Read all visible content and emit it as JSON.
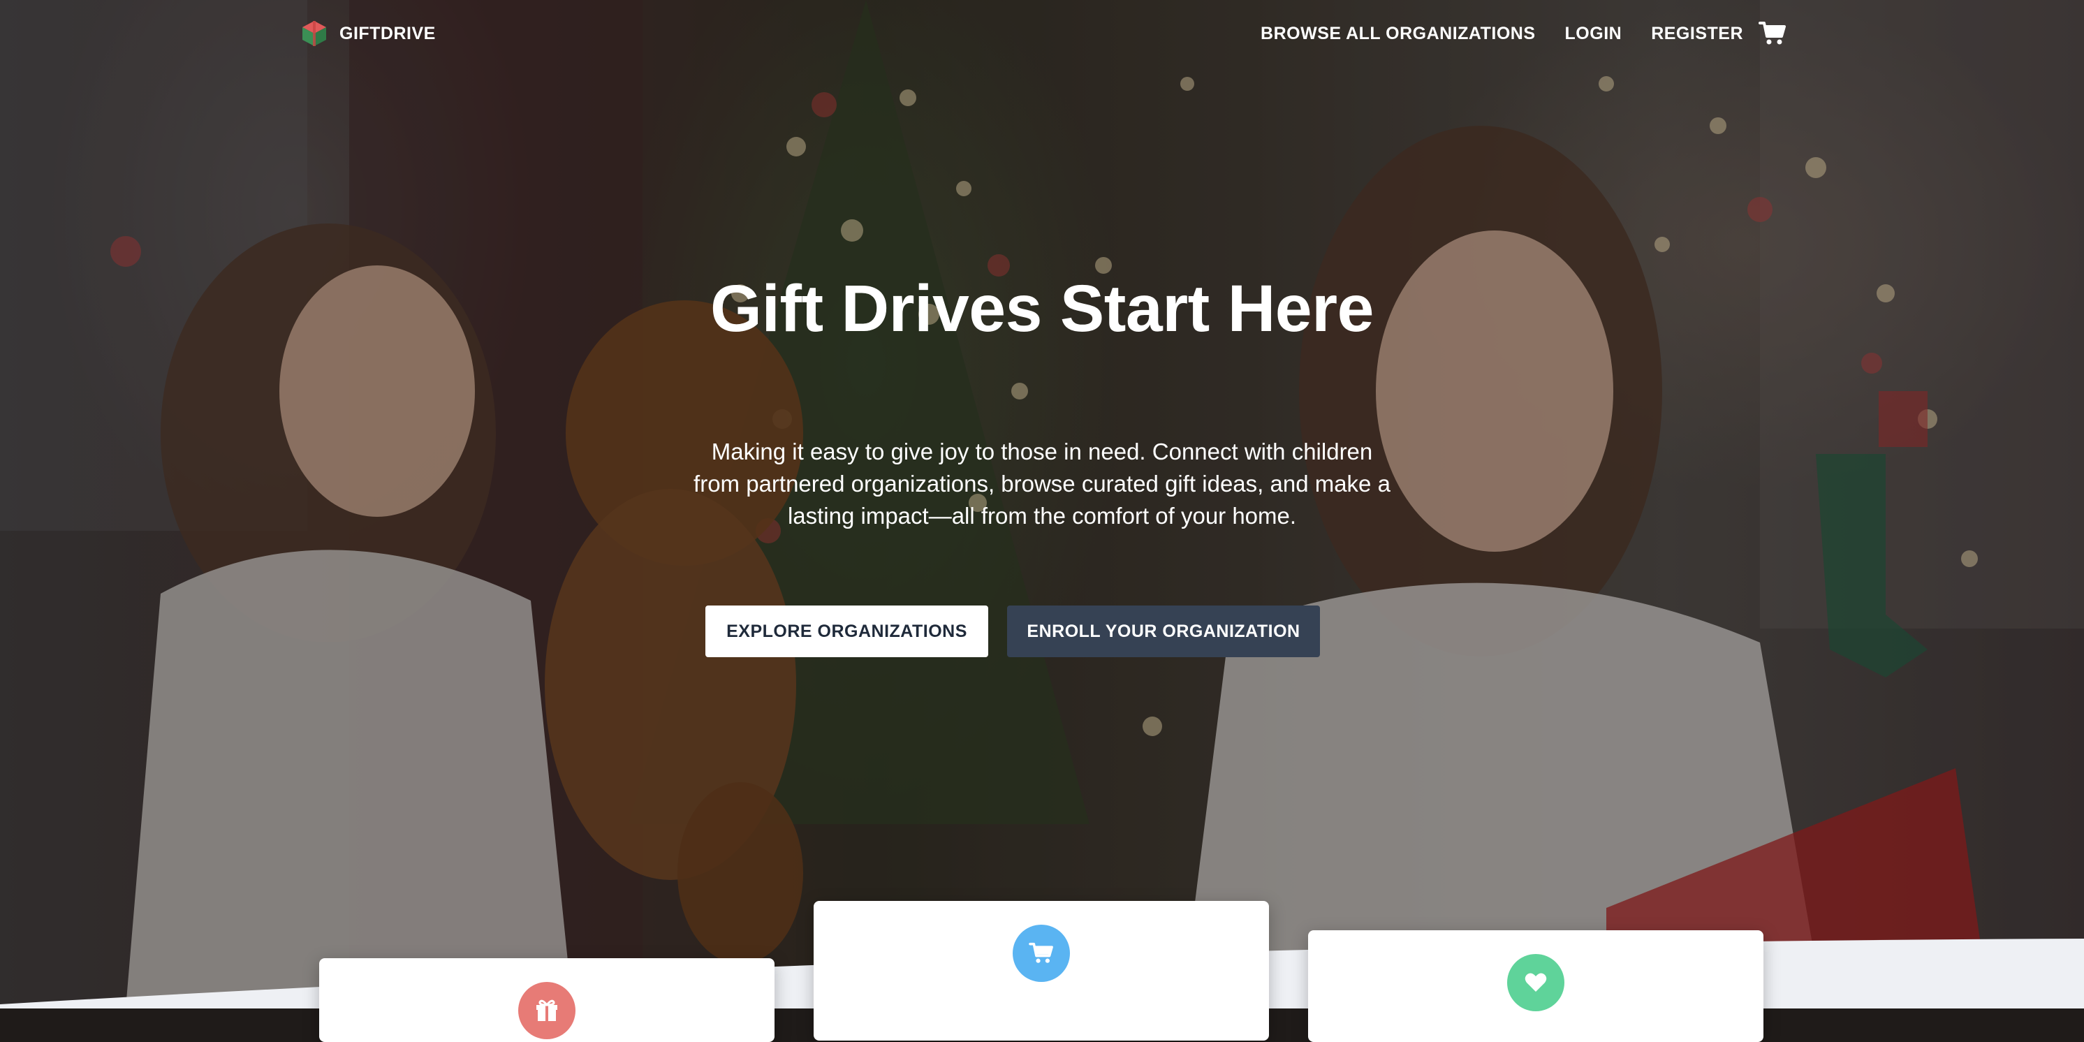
{
  "brand": {
    "name": "GIFTDRIVE",
    "logo_icon": "gift-cube-icon"
  },
  "nav": {
    "links": [
      {
        "label": "BROWSE ALL ORGANIZATIONS"
      },
      {
        "label": "LOGIN"
      },
      {
        "label": "REGISTER"
      }
    ],
    "cart_icon": "cart-icon"
  },
  "hero": {
    "title": "Gift Drives Start Here",
    "subtitle": "Making it easy to give joy to those in need. Connect with children from partnered organizations, browse curated gift ideas, and make a lasting impact—all from the comfort of your home.",
    "buttons": {
      "explore": "EXPLORE ORGANIZATIONS",
      "enroll": "ENROLL YOUR ORGANIZATION"
    }
  },
  "feature_cards": [
    {
      "icon": "gift-icon",
      "color": "#e77b76"
    },
    {
      "icon": "cart-icon",
      "color": "#5ab4f2"
    },
    {
      "icon": "heart-icon",
      "color": "#5fd39a"
    }
  ],
  "colors": {
    "enroll_button": "#364254",
    "explore_button_text": "#1f2a3a",
    "section_background": "#eef0f4"
  }
}
